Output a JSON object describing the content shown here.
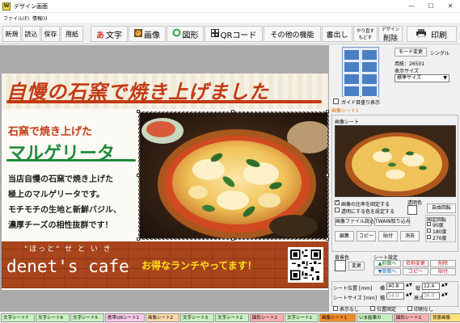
{
  "window": {
    "title": "デザイン画面",
    "icon_label": "W",
    "minimize": "—",
    "maximize": "☐",
    "close": "✕"
  },
  "menubar": [
    "ファイル(F)",
    "情報(I)"
  ],
  "toolbar": {
    "new": "新規",
    "read": "読込",
    "save": "保存",
    "paper": "用紙",
    "text": "文字",
    "text_icon": "あ",
    "image": "画像",
    "shape": "図形",
    "qr": "QRコード",
    "other": "その他の機能",
    "print_out": "書出し",
    "redo_top": "やり直す",
    "redo_bottom": "もどす",
    "delete_top": "デザイン",
    "delete_bottom": "削除",
    "print": "印刷"
  },
  "design": {
    "headline": "自慢の石窯で焼き上げました",
    "sub1": "石窯で焼き上げた",
    "sub2": "マルゲリータ",
    "body": [
      "当店自慢の石窯で焼き上げた",
      "極上のマルゲリータです。",
      "モチモチの生地と新鮮バジル、",
      "濃厚チーズの相性抜群です！"
    ],
    "banner_small": "\"ほっと\" せ と い き",
    "banner_name": "denet's cafe",
    "banner_lunch": "お得なランチやってます！"
  },
  "panel": {
    "mode_change": "モード変更",
    "mode_value": "シングル",
    "paper_label": "用紙：",
    "paper_value": "26501",
    "display_size_label": "表示サイズ",
    "display_size_value": "標準サイズ",
    "guide_checkbox": "ガイド目盛り表示",
    "sheet_title": "画像シート1",
    "sheet_group": "画像シート",
    "keep_ratio": "画像の比率を固定する",
    "transparent_set": "透明にする色を設定する",
    "transparent_color": "透明色",
    "free_rotate": "自由回転",
    "read_file": "画像ファイル読込",
    "twain": "TWAIN取り込み",
    "fixed_rotate": "固定回転",
    "rot90": "90度",
    "rot180": "180度",
    "rot270": "270度",
    "edit": "編集",
    "copy": "コピー",
    "paste": "貼付",
    "clear": "消去",
    "bg_color": "背景色",
    "change": "変更",
    "sheet_settings": "シート設定",
    "to_front": "▲前面へ",
    "to_back": "▼背面へ",
    "rename_top": "名称変更",
    "rename_bottom": "コピー",
    "delete_top": "削除",
    "delete_bottom": "貼付",
    "pos_label": "シート位置 [mm]",
    "size_label": "シートサイズ [mm]",
    "x_label": "横",
    "x_value": "40.8",
    "y_label": "縦",
    "y_value": "12.4",
    "w_label": "幅",
    "w_value": "54.0",
    "h_label": "高さ",
    "h_value": "36.0",
    "hide": "表示なし",
    "fix_pos": "位置固定",
    "no_print": "印刷なし"
  },
  "tabs": [
    {
      "label": "文字シート7",
      "color": "#c8f0c0"
    },
    {
      "label": "文字シート6",
      "color": "#c8f0c0"
    },
    {
      "label": "文字シート5",
      "color": "#c8f0c0"
    },
    {
      "label": "携帯QRシート1",
      "color": "#f8c8e8"
    },
    {
      "label": "画像シート2",
      "color": "#ffd8a8"
    },
    {
      "label": "文字シート3",
      "color": "#c8f0c0"
    },
    {
      "label": "文字シート2",
      "color": "#c8f0c0"
    },
    {
      "label": "図形シート2",
      "color": "#f8b0b0"
    },
    {
      "label": "文字シート1",
      "color": "#c8f0c0"
    },
    {
      "label": "画像シート1",
      "color": "#f28c28"
    },
    {
      "label": "いま結果の",
      "color": "#c8f0c0"
    },
    {
      "label": "図形シート1",
      "color": "#f8b0b0"
    },
    {
      "label": "背景画像",
      "color": "#ffe07a"
    }
  ]
}
